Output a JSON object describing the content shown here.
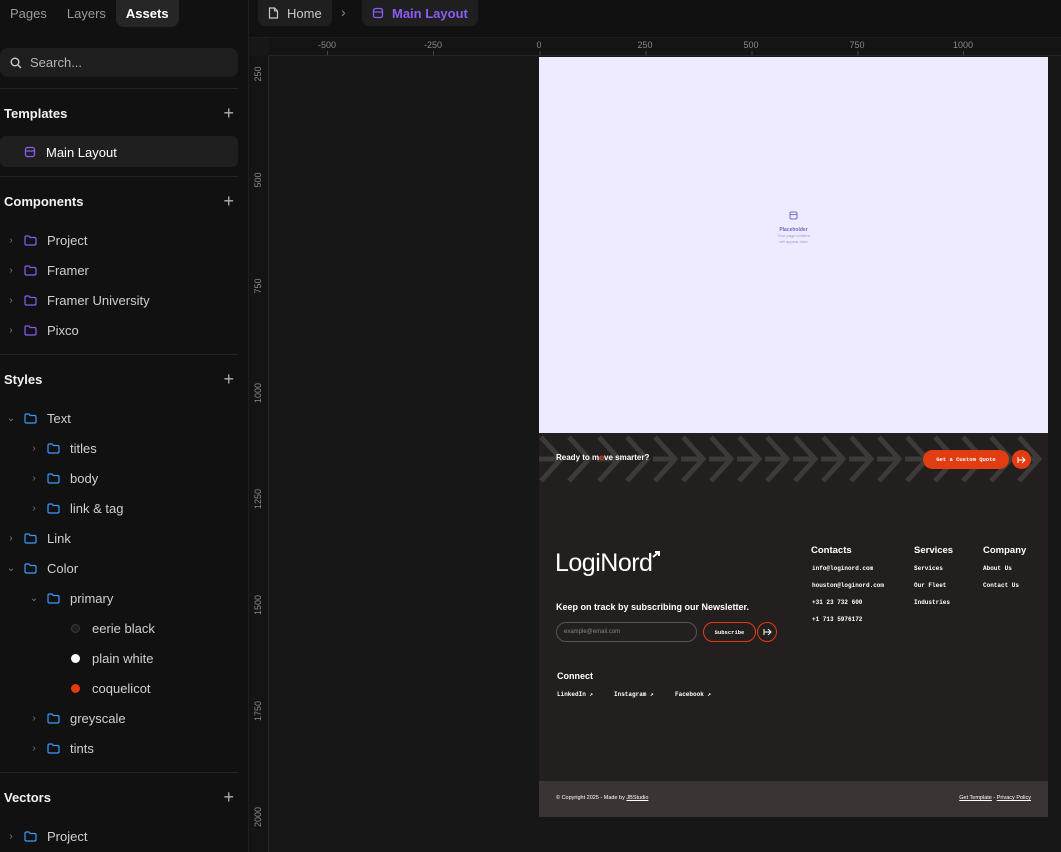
{
  "left_panel": {
    "tabs": [
      "Pages",
      "Layers",
      "Assets"
    ],
    "active_tab": "Assets",
    "search_placeholder": "Search...",
    "templates": {
      "title": "Templates",
      "items": [
        "Main Layout"
      ]
    },
    "components": {
      "title": "Components",
      "items": [
        "Project",
        "Framer",
        "Framer University",
        "Pixco"
      ]
    },
    "styles": {
      "title": "Styles",
      "text_folder": "Text",
      "text_children": [
        "titles",
        "body",
        "link & tag"
      ],
      "link_folder": "Link",
      "color_folder": "Color",
      "primary_folder": "primary",
      "colors": [
        {
          "name": "eerie black",
          "hex": "#231f1f"
        },
        {
          "name": "plain white",
          "hex": "#ffffff"
        },
        {
          "name": "coquelicot",
          "hex": "#e23d12"
        }
      ],
      "greyscale": "greyscale",
      "tints": "tints"
    },
    "vectors": {
      "title": "Vectors",
      "items": [
        "Project"
      ]
    }
  },
  "topbar": {
    "home": "Home",
    "current": "Main Layout",
    "accent": "#8b5cf6"
  },
  "rulers": {
    "horizontal": [
      "-500",
      "-250",
      "0",
      "250",
      "500",
      "750",
      "1000"
    ],
    "vertical": [
      "250",
      "500",
      "750",
      "1000",
      "1250",
      "1500",
      "1750",
      "2000"
    ]
  },
  "frame": {
    "placeholder": {
      "title": "Placeholder",
      "line1": "Your page content",
      "line2": "will appear here"
    },
    "cta": {
      "text_before": "Ready to m",
      "text_o": "o",
      "text_after": "ve smarter?",
      "button": "Get a Custom Quote"
    },
    "footer": {
      "logo": "LogiNord",
      "newsletter_title": "Keep on track by subscribing our Newsletter.",
      "email_placeholder": "example@email.com",
      "subscribe": "Subscribe",
      "connect_title": "Connect",
      "social": [
        "LinkedIn ↗",
        "Instagram ↗",
        "Facebook ↗"
      ],
      "contacts_title": "Contacts",
      "contacts": [
        "info@loginord.com",
        "houston@loginord.com",
        "+31 23 732 600",
        "+1 713 5976172"
      ],
      "services_title": "Services",
      "services": [
        "Services",
        "Our Fleet",
        "Industries"
      ],
      "company_title": "Company",
      "company": [
        "About Us",
        "Contact Us"
      ]
    },
    "bottom": {
      "copyright": "© Copyright 2025 - Made by ",
      "studio": "JBStudio",
      "get_template": "Get Template",
      "separator": " - ",
      "privacy": "Privacy Policy"
    },
    "brand_colors": {
      "dark": "#231f1f",
      "accent": "#e23d12",
      "bottom_bar": "#3a3434"
    }
  }
}
